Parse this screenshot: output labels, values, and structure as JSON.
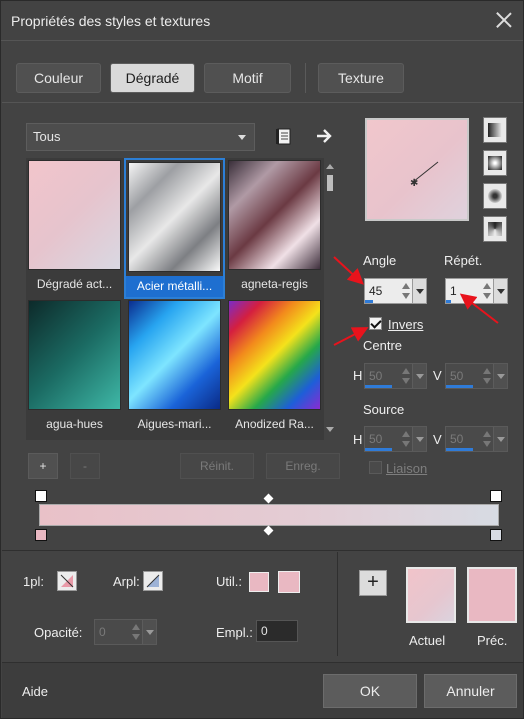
{
  "title": "Propriétés des styles et textures",
  "tabs": [
    {
      "label": "Couleur"
    },
    {
      "label": "Dégradé"
    },
    {
      "label": "Motif"
    },
    {
      "label": "Texture"
    }
  ],
  "filter": {
    "selected": "Tous"
  },
  "gradients": [
    {
      "label": "Dégradé act...",
      "colors": [
        "#f2c5cb",
        "#e6c4cd",
        "#d9d8e2"
      ]
    },
    {
      "label": "Acier métalli...",
      "colors": [
        "#f5f5f5",
        "#9d9fa3",
        "#e8e8e8",
        "#7d7f83",
        "#fafafa"
      ]
    },
    {
      "label": "agneta-regis",
      "colors": [
        "#3a2f3a",
        "#b09aa5",
        "#6b3a43",
        "#f0e0e6",
        "#3e2f3c"
      ]
    },
    {
      "label": "agua-hues",
      "colors": [
        "#0d2a2a",
        "#1b6b63",
        "#3fb8a7"
      ]
    },
    {
      "label": "Aigues-mari...",
      "colors": [
        "#0b2d8f",
        "#27a4f0",
        "#7ee5ff",
        "#1a63d8",
        "#0a2a86"
      ]
    },
    {
      "label": "Anodized Ra...",
      "colors": [
        "#7b2cc7",
        "#d41f3f",
        "#f28a1c",
        "#f4e21b",
        "#26a84a",
        "#1e5ed8",
        "#8a2bd2"
      ]
    }
  ],
  "gradient_buttons": {
    "add": "+",
    "remove": "-",
    "reset": "Réinit.",
    "save": "Enreg."
  },
  "labels": {
    "angle": "Angle",
    "repeat": "Répét.",
    "invert": "Invers",
    "center": "Centre",
    "source": "Source",
    "h": "H",
    "v": "V",
    "link": "Liaison"
  },
  "values": {
    "angle": "45",
    "repeat": "1",
    "center_h": "50",
    "center_v": "50",
    "source_h": "50",
    "source_v": "50",
    "opacity": "0",
    "position": "0"
  },
  "options": {
    "invert_checked": true,
    "link_checked": false
  },
  "lower": {
    "type_1pl": "1pl:",
    "type_arpl": "Arpl:",
    "util": "Util.:",
    "opacity": "Opacité:",
    "position": "Empl.:",
    "current": "Actuel",
    "previous": "Préc."
  },
  "footer": {
    "help": "Aide",
    "ok": "OK",
    "cancel": "Annuler"
  },
  "accent": "#2f7bd8",
  "annotation_color": "#e8131c"
}
